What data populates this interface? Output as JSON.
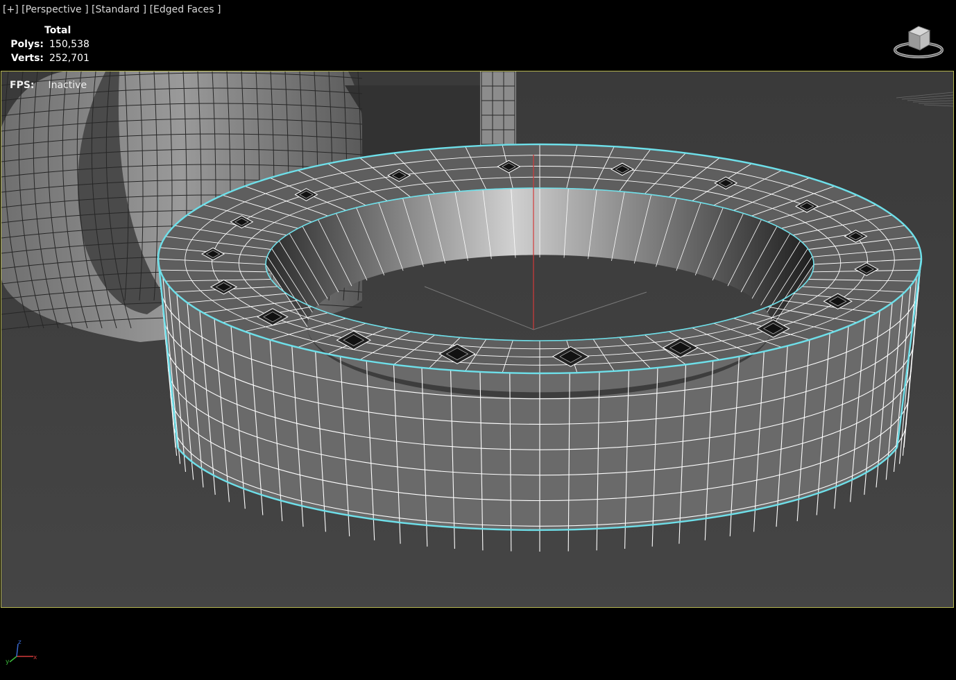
{
  "viewport_label": {
    "plus": "[+]",
    "view": "[Perspective ]",
    "shading": "[Standard ]",
    "mode": "[Edged Faces ]"
  },
  "stats": {
    "header": "Total",
    "polys_label": "Polys:",
    "polys_value": "150,538",
    "verts_label": "Verts:",
    "verts_value": "252,701"
  },
  "fps": {
    "label": "FPS:",
    "value": "Inactive"
  },
  "gizmo": {
    "axis_x": "x",
    "axis_y": "y",
    "axis_z": "z"
  },
  "colors": {
    "viewport_bg": "#3f3f3f",
    "active_border": "#b7b750",
    "selection_outline": "#6ee0ea",
    "wire": "#ffffff",
    "mesh_fill": "#6a6a6a",
    "axis_x": "#d23a3a",
    "axis_y": "#3ab83a",
    "axis_z": "#3a6ad2"
  },
  "icons": [
    "viewcube-icon",
    "axis-tripod-icon"
  ]
}
